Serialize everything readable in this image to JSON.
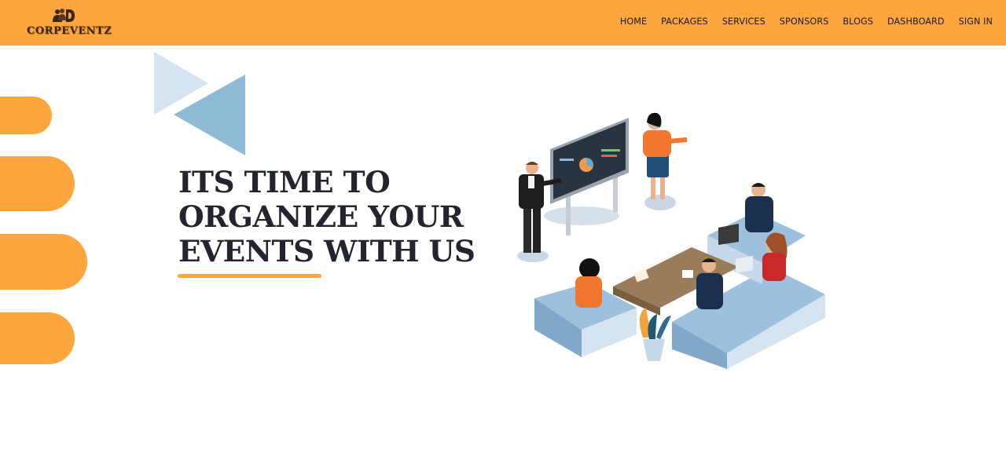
{
  "brand": {
    "name": "CORPEVENTZ",
    "icon": "people-logo-icon"
  },
  "nav": {
    "items": [
      {
        "label": "HOME"
      },
      {
        "label": "PACKAGES"
      },
      {
        "label": "SERVICES"
      },
      {
        "label": "SPONSORS"
      },
      {
        "label": "BLOGS"
      },
      {
        "label": "DASHBOARD"
      },
      {
        "label": "SIGN IN"
      }
    ]
  },
  "hero": {
    "headline": {
      "line1": "ITS TIME TO",
      "line2": "ORGANIZE YOUR",
      "line3": "EVENTS WITH US"
    },
    "illustration": "business-meeting-illustration"
  },
  "colors": {
    "accent": "#fda63d",
    "text_dark": "#22252f",
    "triangle_light": "#d6e4f2",
    "triangle_blue": "#8fbad5"
  }
}
